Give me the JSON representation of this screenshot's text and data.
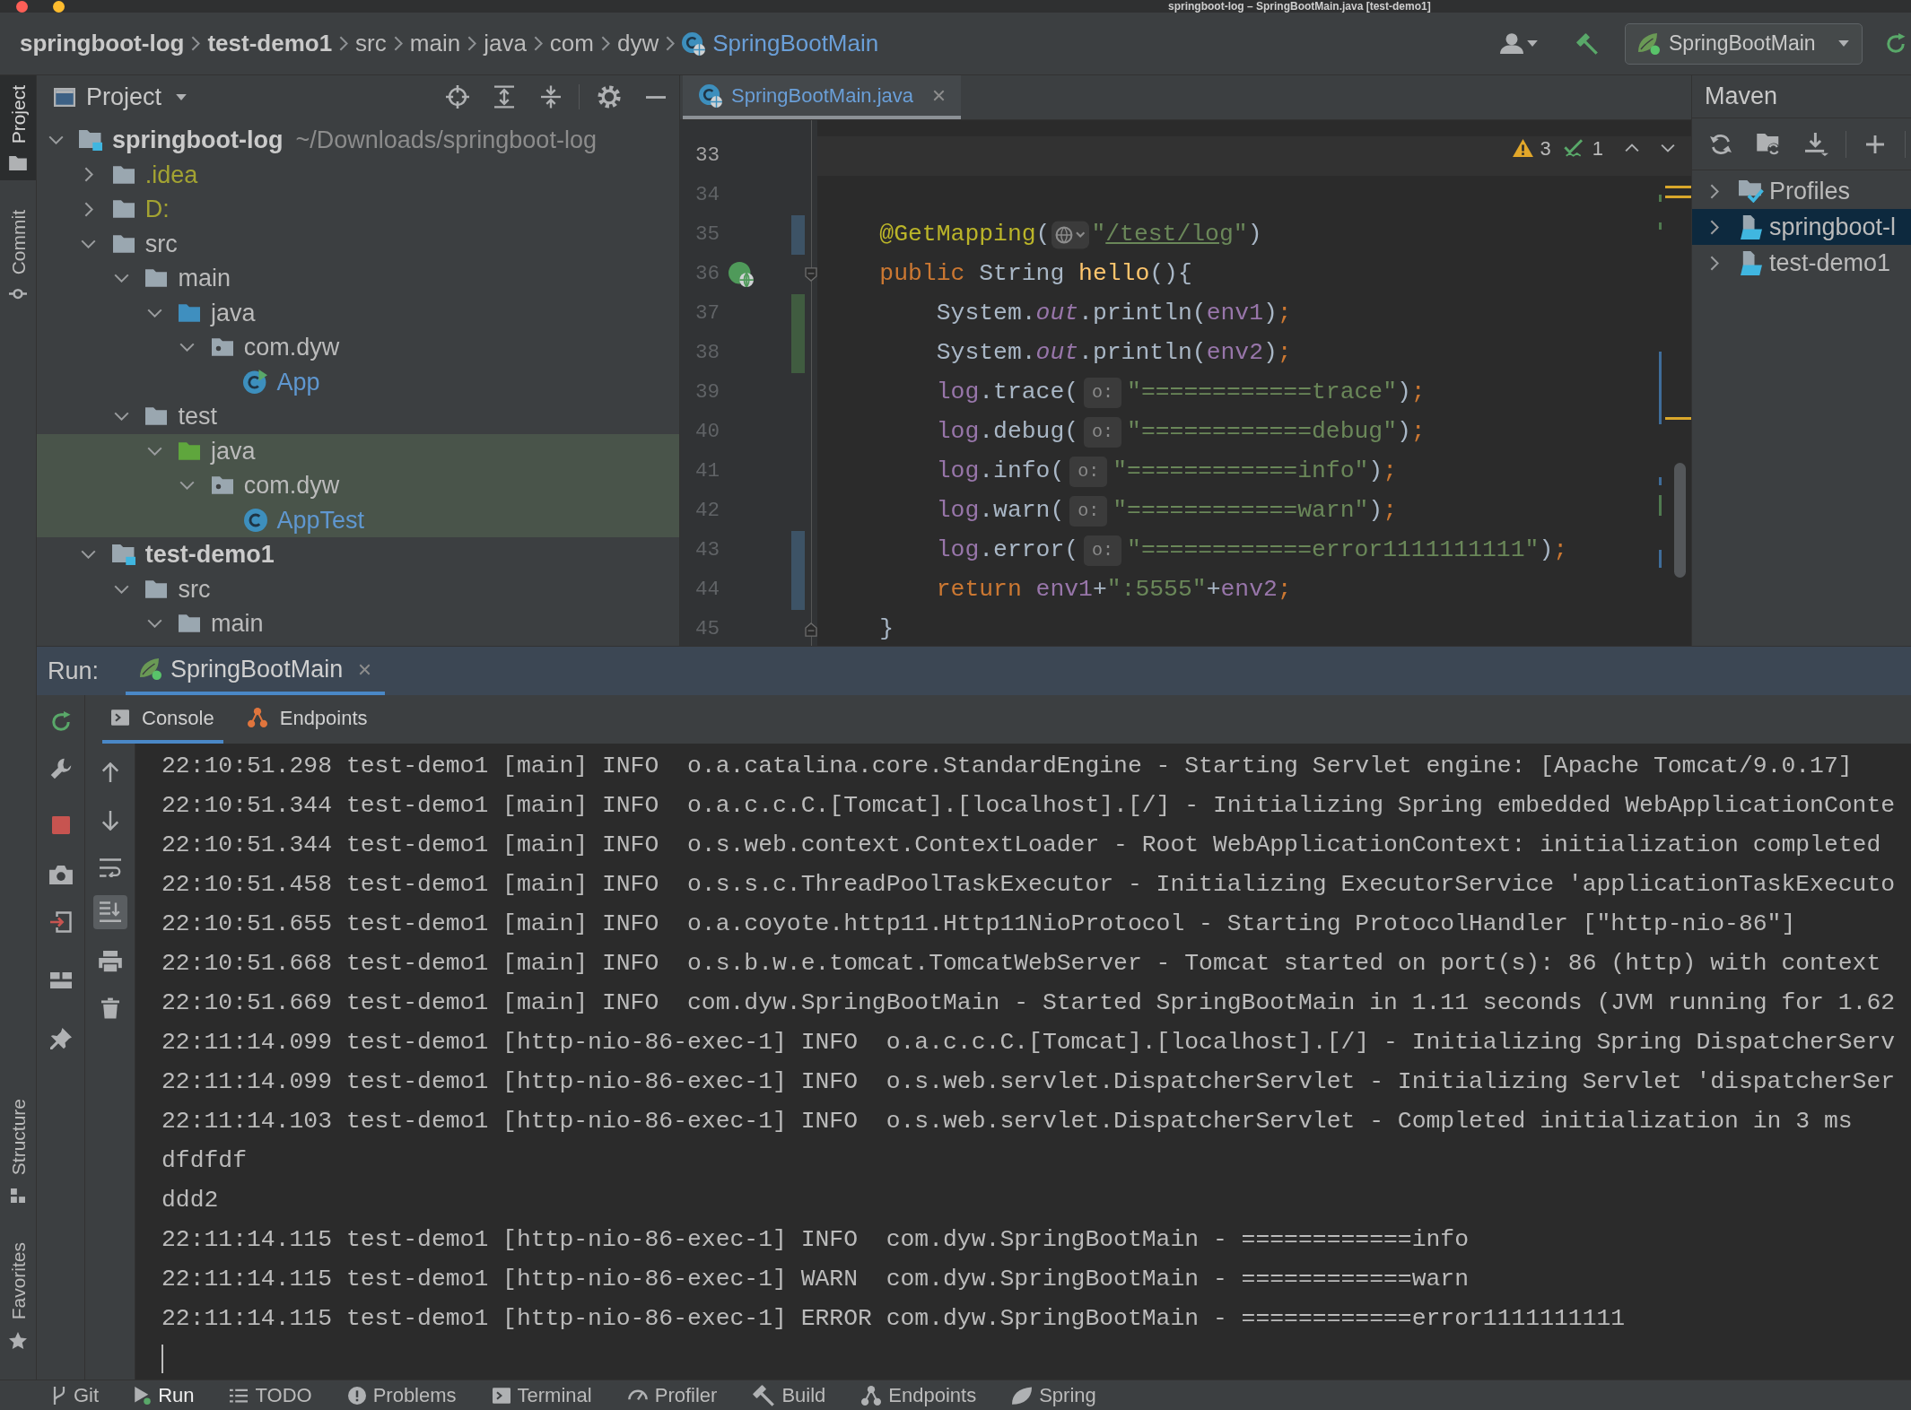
{
  "window": {
    "title": "springboot-log – SpringBootMain.java [test-demo1]"
  },
  "navigation_bar": {
    "breadcrumbs": [
      {
        "label": "springboot-log",
        "kind": "module"
      },
      {
        "label": "test-demo1",
        "kind": "module"
      },
      {
        "label": "src",
        "kind": "folder"
      },
      {
        "label": "main",
        "kind": "folder"
      },
      {
        "label": "java",
        "kind": "folder"
      },
      {
        "label": "com",
        "kind": "folder"
      },
      {
        "label": "dyw",
        "kind": "folder"
      },
      {
        "label": "SpringBootMain",
        "kind": "class"
      }
    ],
    "run_configuration": "SpringBootMain"
  },
  "tool_strip": {
    "top": [
      {
        "label": "Project",
        "kind": "project",
        "selected": true
      },
      {
        "label": "Commit",
        "kind": "commit",
        "selected": false
      }
    ],
    "bottom": [
      {
        "label": "Structure",
        "kind": "structure",
        "selected": false
      },
      {
        "label": "Favorites",
        "kind": "favorites",
        "selected": false
      }
    ]
  },
  "project_panel": {
    "title": "Project",
    "tree": [
      {
        "label": "springboot-log",
        "detail": "~/Downloads/springboot-log",
        "kind": "module",
        "expanded": true,
        "highlighted": false,
        "children": [
          {
            "label": ".idea",
            "kind": "ignored_folder",
            "expanded": false,
            "highlighted": false
          },
          {
            "label": "D:",
            "kind": "ignored_folder",
            "expanded": false,
            "highlighted": false
          },
          {
            "label": "src",
            "kind": "folder",
            "expanded": true,
            "highlighted": false,
            "children": [
              {
                "label": "main",
                "kind": "folder",
                "expanded": true,
                "highlighted": false,
                "children": [
                  {
                    "label": "java",
                    "kind": "source_root",
                    "expanded": true,
                    "highlighted": false,
                    "children": [
                      {
                        "label": "com.dyw",
                        "kind": "package",
                        "expanded": true,
                        "highlighted": false,
                        "children": [
                          {
                            "label": "App",
                            "kind": "main_class",
                            "highlighted": false
                          }
                        ]
                      }
                    ]
                  }
                ]
              },
              {
                "label": "test",
                "kind": "folder",
                "expanded": true,
                "highlighted": false,
                "children": [
                  {
                    "label": "java",
                    "kind": "test_root",
                    "expanded": true,
                    "highlighted": true,
                    "children": [
                      {
                        "label": "com.dyw",
                        "kind": "package",
                        "expanded": true,
                        "highlighted": true,
                        "children": [
                          {
                            "label": "AppTest",
                            "kind": "class",
                            "highlighted": true
                          }
                        ]
                      }
                    ]
                  }
                ]
              }
            ]
          },
          {
            "label": "test-demo1",
            "kind": "module",
            "expanded": true,
            "highlighted": false,
            "children": [
              {
                "label": "src",
                "kind": "folder",
                "expanded": true,
                "highlighted": false,
                "children": [
                  {
                    "label": "main",
                    "kind": "folder",
                    "expanded": true,
                    "highlighted": false
                  }
                ]
              }
            ]
          }
        ]
      }
    ]
  },
  "editor": {
    "tabs": [
      {
        "label": "SpringBootMain.java",
        "selected": true
      }
    ],
    "inspections": {
      "warnings": "3",
      "weak_warnings": "1"
    },
    "lines": [
      {
        "number": "33",
        "current": true
      },
      {
        "number": "34",
        "current": false
      },
      {
        "number": "35",
        "current": false,
        "change": {
          "kind": "modified"
        },
        "tokens": [
          {
            "text": "    @GetMapping",
            "kind": "annotation"
          },
          {
            "text": "(",
            "kind": "plain"
          },
          {
            "kind": "endpoint_inlay"
          },
          {
            "text": "\"",
            "kind": "string"
          },
          {
            "text": "/test/log",
            "kind": "url"
          },
          {
            "text": "\"",
            "kind": "string"
          },
          {
            "text": ")",
            "kind": "plain"
          }
        ]
      },
      {
        "number": "36",
        "current": false,
        "gutter_icon": {
          "kind": "endpoint"
        },
        "fold": {
          "kind": "start"
        },
        "tokens": [
          {
            "text": "    public",
            "kind": "keyword"
          },
          {
            "text": " String ",
            "kind": "plain"
          },
          {
            "text": "hello",
            "kind": "method"
          },
          {
            "text": "(){",
            "kind": "plain"
          }
        ]
      },
      {
        "number": "37",
        "current": false,
        "change": {
          "kind": "added"
        },
        "tokens": [
          {
            "text": "        System.",
            "kind": "plain"
          },
          {
            "text": "out",
            "kind": "static_field"
          },
          {
            "text": ".println(",
            "kind": "plain"
          },
          {
            "text": "env1",
            "kind": "field"
          },
          {
            "text": ")",
            "kind": "plain"
          },
          {
            "text": ";",
            "kind": "semicolon"
          }
        ]
      },
      {
        "number": "38",
        "current": false,
        "change": {
          "kind": "added"
        },
        "tokens": [
          {
            "text": "        System.",
            "kind": "plain"
          },
          {
            "text": "out",
            "kind": "static_field"
          },
          {
            "text": ".println(",
            "kind": "plain"
          },
          {
            "text": "env2",
            "kind": "field"
          },
          {
            "text": ")",
            "kind": "plain"
          },
          {
            "text": ";",
            "kind": "semicolon"
          }
        ]
      },
      {
        "number": "39",
        "current": false,
        "tokens": [
          {
            "text": "        log",
            "kind": "field"
          },
          {
            "text": ".trace(",
            "kind": "plain"
          },
          {
            "text": "o:",
            "kind": "hint"
          },
          {
            "text": "\"============trace\"",
            "kind": "string"
          },
          {
            "text": ")",
            "kind": "plain"
          },
          {
            "text": ";",
            "kind": "semicolon"
          }
        ]
      },
      {
        "number": "40",
        "current": false,
        "tokens": [
          {
            "text": "        log",
            "kind": "field"
          },
          {
            "text": ".debug(",
            "kind": "plain"
          },
          {
            "text": "o:",
            "kind": "hint"
          },
          {
            "text": "\"============debug\"",
            "kind": "string"
          },
          {
            "text": ")",
            "kind": "plain"
          },
          {
            "text": ";",
            "kind": "semicolon"
          }
        ]
      },
      {
        "number": "41",
        "current": false,
        "tokens": [
          {
            "text": "        log",
            "kind": "field"
          },
          {
            "text": ".info(",
            "kind": "plain"
          },
          {
            "text": "o:",
            "kind": "hint"
          },
          {
            "text": "\"============info\"",
            "kind": "string"
          },
          {
            "text": ")",
            "kind": "plain"
          },
          {
            "text": ";",
            "kind": "semicolon"
          }
        ]
      },
      {
        "number": "42",
        "current": false,
        "tokens": [
          {
            "text": "        log",
            "kind": "field"
          },
          {
            "text": ".warn(",
            "kind": "plain"
          },
          {
            "text": "o:",
            "kind": "hint"
          },
          {
            "text": "\"============warn\"",
            "kind": "string"
          },
          {
            "text": ")",
            "kind": "plain"
          },
          {
            "text": ";",
            "kind": "semicolon"
          }
        ]
      },
      {
        "number": "43",
        "current": false,
        "change": {
          "kind": "modified"
        },
        "tokens": [
          {
            "text": "        log",
            "kind": "field"
          },
          {
            "text": ".error(",
            "kind": "plain"
          },
          {
            "text": "o:",
            "kind": "hint"
          },
          {
            "text": "\"============error1111111111\"",
            "kind": "string"
          },
          {
            "text": ")",
            "kind": "plain"
          },
          {
            "text": ";",
            "kind": "semicolon"
          }
        ]
      },
      {
        "number": "44",
        "current": false,
        "change": {
          "kind": "modified"
        },
        "tokens": [
          {
            "text": "        return ",
            "kind": "keyword"
          },
          {
            "text": "env1",
            "kind": "field"
          },
          {
            "text": "+",
            "kind": "plain"
          },
          {
            "text": "\":5555\"",
            "kind": "string"
          },
          {
            "text": "+",
            "kind": "plain"
          },
          {
            "text": "env2",
            "kind": "field"
          },
          {
            "text": ";",
            "kind": "semicolon"
          }
        ]
      },
      {
        "number": "45",
        "current": false,
        "fold": {
          "kind": "end"
        },
        "tokens": [
          {
            "text": "    }",
            "kind": "plain"
          }
        ]
      }
    ]
  },
  "maven_panel": {
    "title": "Maven",
    "tree": [
      {
        "label": "Profiles",
        "kind": "profiles",
        "expanded": false,
        "selected": false
      },
      {
        "label": "springboot-l",
        "kind": "module",
        "expanded": false,
        "selected": true
      },
      {
        "label": "test-demo1",
        "kind": "module",
        "expanded": false,
        "selected": false
      }
    ]
  },
  "run_panel": {
    "label": "Run:",
    "tabs": [
      {
        "label": "SpringBootMain",
        "selected": true
      }
    ],
    "console_tabs": [
      {
        "label": "Console",
        "kind": "console",
        "selected": true
      },
      {
        "label": "Endpoints",
        "kind": "endpoints",
        "selected": false
      }
    ],
    "scroll_to_end": true,
    "console_lines": [
      "22:10:51.298 test-demo1 [main] INFO  o.a.catalina.core.StandardEngine - Starting Servlet engine: [Apache Tomcat/9.0.17]",
      "22:10:51.344 test-demo1 [main] INFO  o.a.c.c.C.[Tomcat].[localhost].[/] - Initializing Spring embedded WebApplicationConte",
      "22:10:51.344 test-demo1 [main] INFO  o.s.web.context.ContextLoader - Root WebApplicationContext: initialization completed",
      "22:10:51.458 test-demo1 [main] INFO  o.s.s.c.ThreadPoolTaskExecutor - Initializing ExecutorService 'applicationTaskExecuto",
      "22:10:51.655 test-demo1 [main] INFO  o.a.coyote.http11.Http11NioProtocol - Starting ProtocolHandler [\"http-nio-86\"]",
      "22:10:51.668 test-demo1 [main] INFO  o.s.b.w.e.tomcat.TomcatWebServer - Tomcat started on port(s): 86 (http) with context",
      "22:10:51.669 test-demo1 [main] INFO  com.dyw.SpringBootMain - Started SpringBootMain in 1.11 seconds (JVM running for 1.62",
      "22:11:14.099 test-demo1 [http-nio-86-exec-1] INFO  o.a.c.c.C.[Tomcat].[localhost].[/] - Initializing Spring DispatcherServ",
      "22:11:14.099 test-demo1 [http-nio-86-exec-1] INFO  o.s.web.servlet.DispatcherServlet - Initializing Servlet 'dispatcherSer",
      "22:11:14.103 test-demo1 [http-nio-86-exec-1] INFO  o.s.web.servlet.DispatcherServlet - Completed initialization in 3 ms",
      "dfdfdf",
      "ddd2",
      "22:11:14.115 test-demo1 [http-nio-86-exec-1] INFO  com.dyw.SpringBootMain - ============info",
      "22:11:14.115 test-demo1 [http-nio-86-exec-1] WARN  com.dyw.SpringBootMain - ============warn",
      "22:11:14.115 test-demo1 [http-nio-86-exec-1] ERROR com.dyw.SpringBootMain - ============error1111111111"
    ]
  },
  "status_bar": [
    {
      "label": "Git",
      "kind": "git",
      "selected": false
    },
    {
      "label": "Run",
      "kind": "run",
      "selected": true
    },
    {
      "label": "TODO",
      "kind": "todo",
      "selected": false
    },
    {
      "label": "Problems",
      "kind": "problems",
      "selected": false
    },
    {
      "label": "Terminal",
      "kind": "terminal",
      "selected": false
    },
    {
      "label": "Profiler",
      "kind": "profiler",
      "selected": false
    },
    {
      "label": "Build",
      "kind": "build",
      "selected": false
    },
    {
      "label": "Endpoints",
      "kind": "endpoints",
      "selected": false
    },
    {
      "label": "Spring",
      "kind": "spring",
      "selected": false
    }
  ]
}
